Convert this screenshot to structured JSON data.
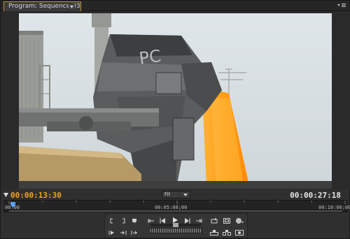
{
  "header": {
    "tab_label": "Program: Sequence 03",
    "tab_dropdown_icon": "chevron-down-icon",
    "panel_menu_icon": "panel-menu-icon"
  },
  "viewer": {
    "overlay_text": "PC"
  },
  "info": {
    "current_timecode": "00:00:13:30",
    "zoom_level": "Fit",
    "duration_timecode": "00:00:27:18"
  },
  "ruler": {
    "labels": [
      "00:00",
      "00:05:00;00",
      "00:10:00;00"
    ]
  },
  "colors": {
    "accent_timecode": "#f0a225",
    "tab_border": "#b3933a",
    "molten": "#ff9c10"
  },
  "controls": {
    "row1": [
      "mark-in-icon",
      "mark-out-icon",
      "add-marker-icon",
      "go-to-in-icon",
      "step-back-icon",
      "play-icon",
      "step-forward-icon",
      "go-to-out-icon",
      "loop-icon",
      "safe-margins-icon",
      "output-icon"
    ],
    "row2": [
      "play-in-to-out-icon",
      "trim-back-icon",
      "trim-forward-icon",
      "lift-icon",
      "extract-icon",
      "export-frame-icon"
    ]
  }
}
